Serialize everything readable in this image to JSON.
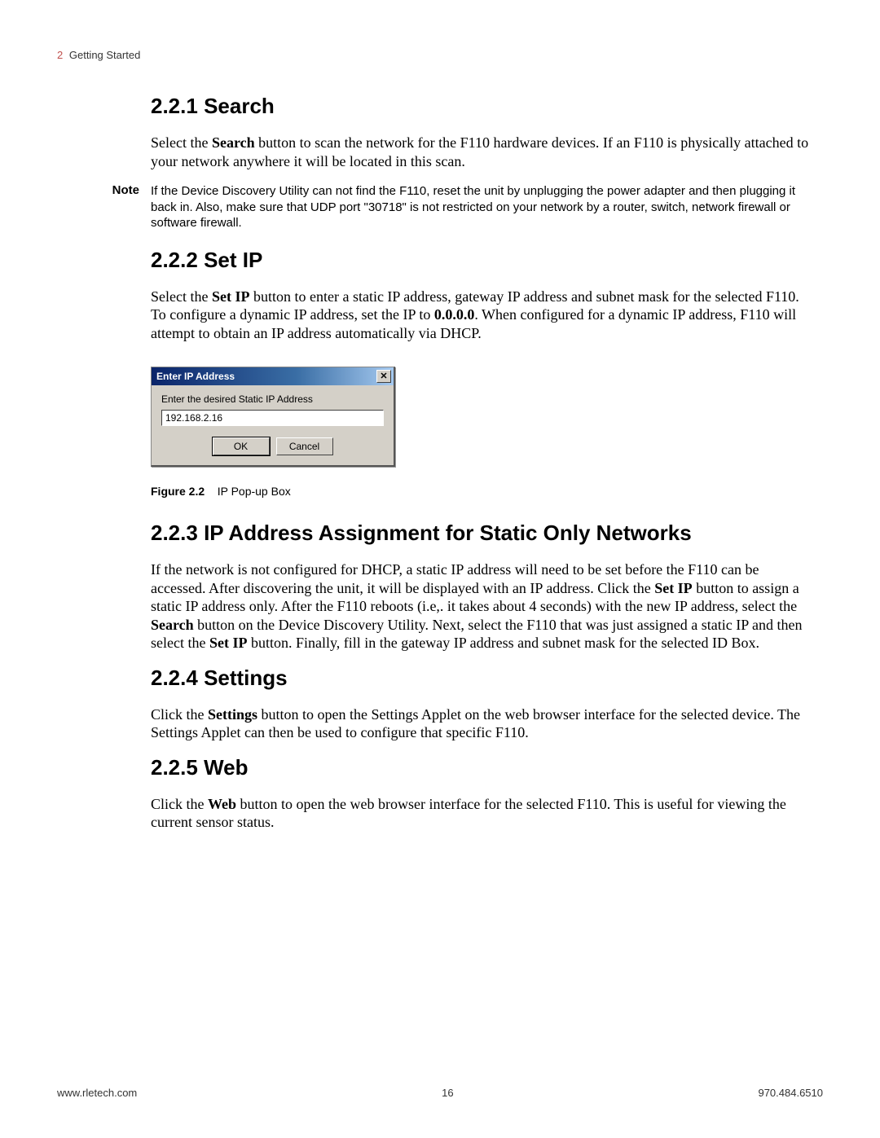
{
  "header": {
    "chapter_num": "2",
    "chapter_title": "Getting Started"
  },
  "sections": {
    "s1": {
      "num": "2.2.1",
      "title": "Search"
    },
    "s2": {
      "num": "2.2.2",
      "title": "Set IP"
    },
    "s3": {
      "num": "2.2.3",
      "title": "IP Address Assignment for Static Only Networks"
    },
    "s4": {
      "num": "2.2.4",
      "title": "Settings"
    },
    "s5": {
      "num": "2.2.5",
      "title": "Web"
    }
  },
  "paragraphs": {
    "p1_a": "Select the ",
    "p1_b": "Search",
    "p1_c": " button to scan the network for the F110 hardware devices. If an F110 is physically attached to your network anywhere it will be located in this scan.",
    "note_label": "Note",
    "note_body": "If the Device Discovery Utility can not find the F110, reset the unit by unplugging the power adapter and then plugging it back in. Also, make sure that UDP port \"30718\" is not restricted on your network by a router, switch, network firewall or software firewall.",
    "p2_a": "Select the ",
    "p2_b": "Set IP",
    "p2_c": " button to enter a static IP address, gateway IP address and subnet mask for the selected F110. To configure a dynamic IP address, set the IP to ",
    "p2_d": "0.0.0.0",
    "p2_e": ". When configured for a dynamic IP address, F110 will attempt to obtain an IP address automatically via DHCP.",
    "p3_a": "If the network is not configured for DHCP, a static IP address will need to be set before the F110 can be accessed. After discovering the unit, it will be displayed with an IP address. Click the ",
    "p3_b": "Set IP",
    "p3_c": " button to assign a static IP address only. After the F110 reboots (i.e,. it takes about 4 seconds) with the new IP address, select the ",
    "p3_d": "Search",
    "p3_e": " button on the Device Discovery Utility. Next, select the F110 that was just assigned a static IP and then select the ",
    "p3_f": "Set IP",
    "p3_g": " button. Finally, fill in the gateway IP address and subnet mask for the selected ID Box.",
    "p4_a": "Click the ",
    "p4_b": "Settings",
    "p4_c": " button to open the Settings Applet on the web browser interface for the selected device. The Settings Applet can then be used to configure that specific F110.",
    "p5_a": "Click the ",
    "p5_b": "Web",
    "p5_c": " button to open the web browser interface for the selected F110. This is useful for viewing the current sensor status."
  },
  "dialog": {
    "title": "Enter IP Address",
    "close": "✕",
    "label": "Enter the desired Static IP Address",
    "value": "192.168.2.16",
    "ok": "OK",
    "cancel": "Cancel"
  },
  "figure": {
    "label": "Figure 2.2",
    "caption": "IP Pop-up Box"
  },
  "footer": {
    "left": "www.rletech.com",
    "center": "16",
    "right": "970.484.6510"
  }
}
